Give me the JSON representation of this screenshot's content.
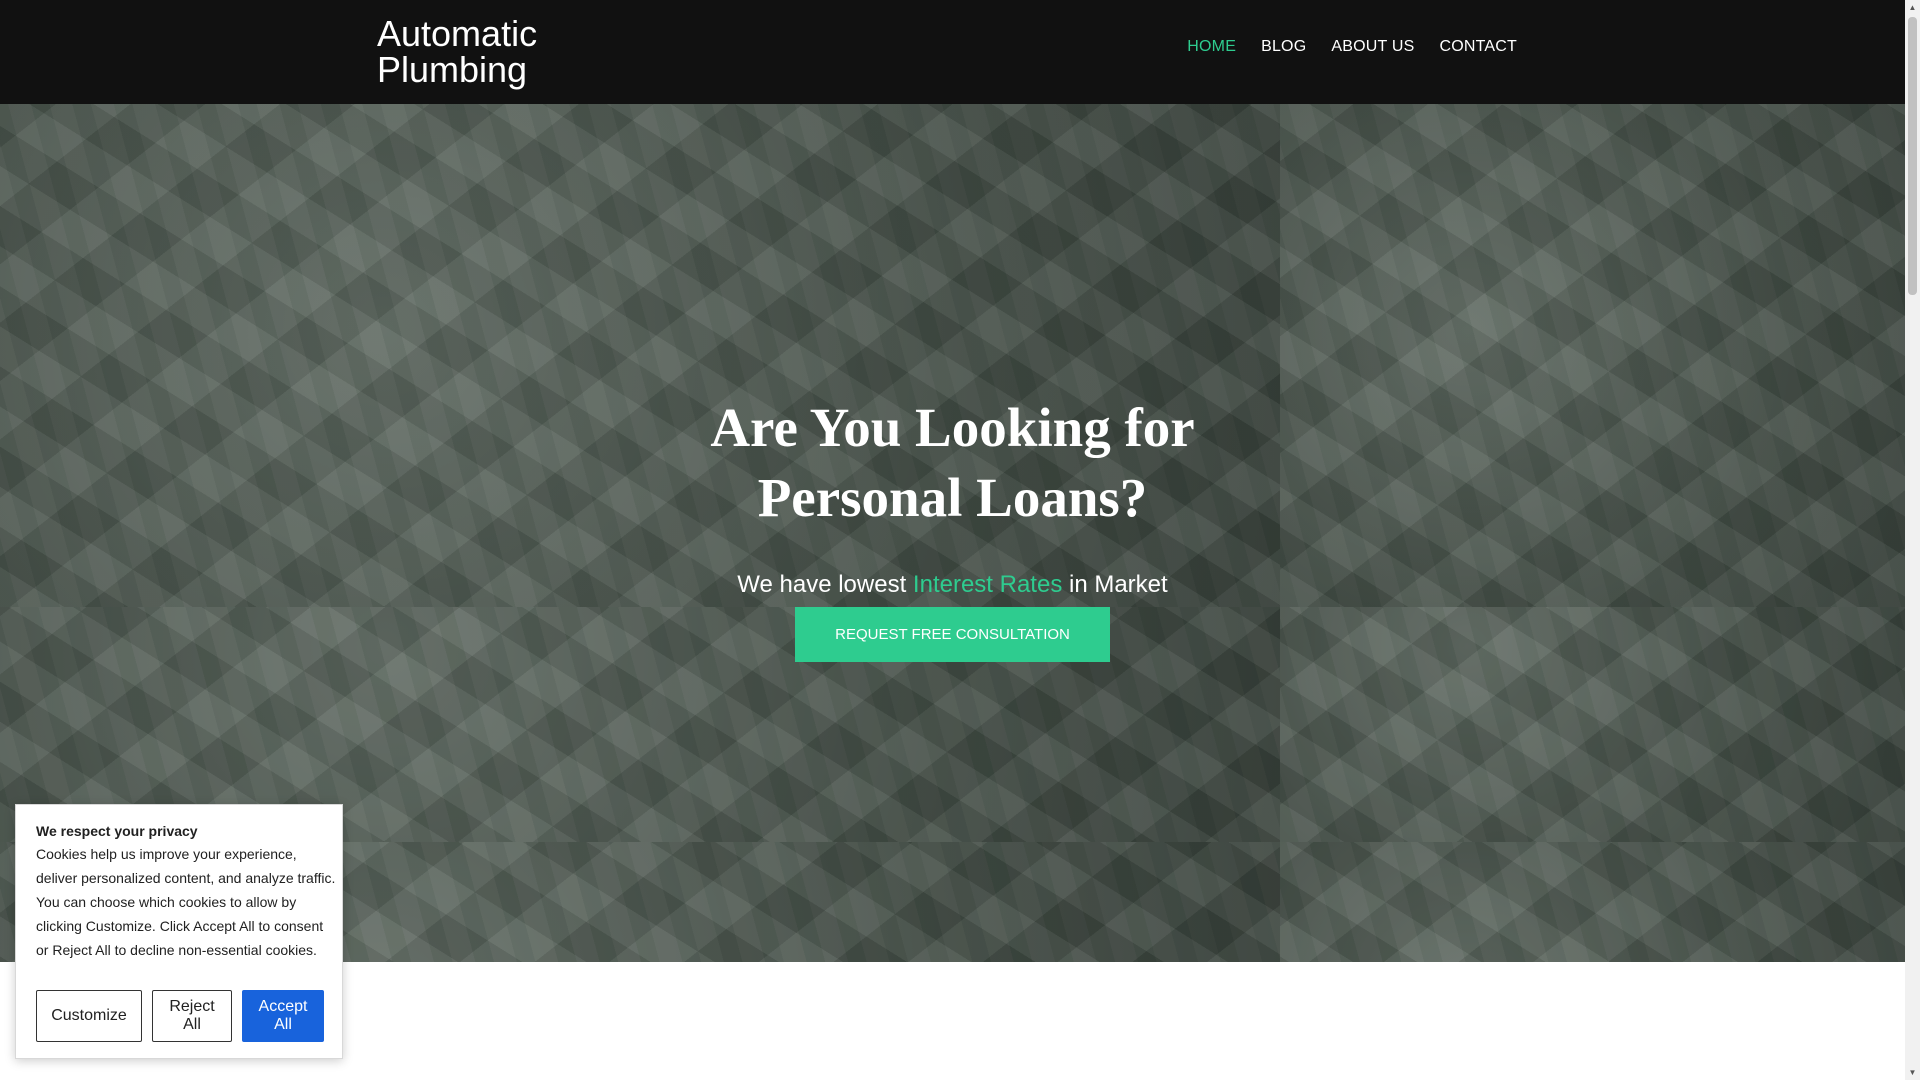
{
  "header": {
    "brand": "Automatic Plumbing",
    "nav": [
      {
        "label": "HOME",
        "active": true
      },
      {
        "label": "BLOG",
        "active": false
      },
      {
        "label": "ABOUT US",
        "active": false
      },
      {
        "label": "CONTACT",
        "active": false
      }
    ]
  },
  "hero": {
    "title": "Are You Looking for Personal Loans?",
    "subtitle_before": "We have lowest ",
    "subtitle_accent": "Interest Rates",
    "subtitle_after": " in Market",
    "cta_label": "REQUEST FREE CONSULTATION",
    "background": "dollar-bills-photo"
  },
  "cookie_banner": {
    "title": "We respect your privacy",
    "text": "Cookies help us improve your experience, deliver personalized content, and analyze traffic. You can choose which cookies to allow by clicking Customize. Click Accept All to consent or Reject All to decline non-essential cookies.",
    "customize_label": "Customize",
    "reject_label": "Reject All",
    "accept_label": "Accept All"
  },
  "colors": {
    "header_bg": "#111111",
    "accent": "#2ecc8f",
    "primary_button": "#1863dc"
  }
}
